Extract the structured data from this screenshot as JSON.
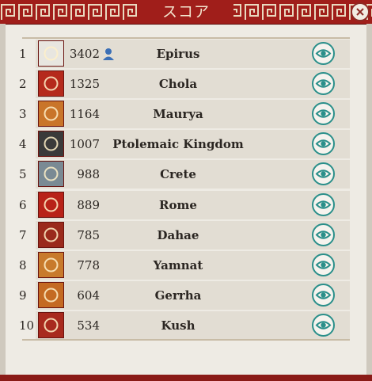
{
  "window": {
    "title": "スコア",
    "close_icon": "close-x-icon",
    "eye_icon": "eye-icon",
    "human_icon": "person-icon"
  },
  "colors": {
    "header": "#a01e1a",
    "accent": "#2a8f8a",
    "rowBg": "#e2ddd3"
  },
  "rows": [
    {
      "rank": "1",
      "score": "3402",
      "name": "Epirus",
      "human": true,
      "flag_icon": "crossed-swords-banner",
      "flag_bg": "#e8e6e0"
    },
    {
      "rank": "2",
      "score": "1325",
      "name": "Chola",
      "human": false,
      "flag_icon": "tiger-banner",
      "flag_bg": "#b52a1c"
    },
    {
      "rank": "3",
      "score": "1164",
      "name": "Maurya",
      "human": false,
      "flag_icon": "white-flower-banner",
      "flag_bg": "#c9752a"
    },
    {
      "rank": "4",
      "score": "1007",
      "name": "Ptolemaic Kingdom",
      "human": false,
      "flag_icon": "sunburst-banner",
      "flag_bg": "#3a3a3a"
    },
    {
      "rank": "5",
      "score": "988",
      "name": "Crete",
      "human": false,
      "flag_icon": "bull-head-banner",
      "flag_bg": "#7a8a94"
    },
    {
      "rank": "6",
      "score": "889",
      "name": "Rome",
      "human": false,
      "flag_icon": "eagle-banner",
      "flag_bg": "#b82218"
    },
    {
      "rank": "7",
      "score": "785",
      "name": "Dahae",
      "human": false,
      "flag_icon": "wheel-banner",
      "flag_bg": "#9a2a1c"
    },
    {
      "rank": "8",
      "score": "778",
      "name": "Yamnat",
      "human": false,
      "flag_icon": "green-emblem-banner",
      "flag_bg": "#c87a2c"
    },
    {
      "rank": "9",
      "score": "604",
      "name": "Gerrha",
      "human": false,
      "flag_icon": "sun-wreath-banner",
      "flag_bg": "#c46a22"
    },
    {
      "rank": "10",
      "score": "534",
      "name": "Kush",
      "human": false,
      "flag_icon": "winged-emblem-banner",
      "flag_bg": "#a82a1e"
    }
  ]
}
